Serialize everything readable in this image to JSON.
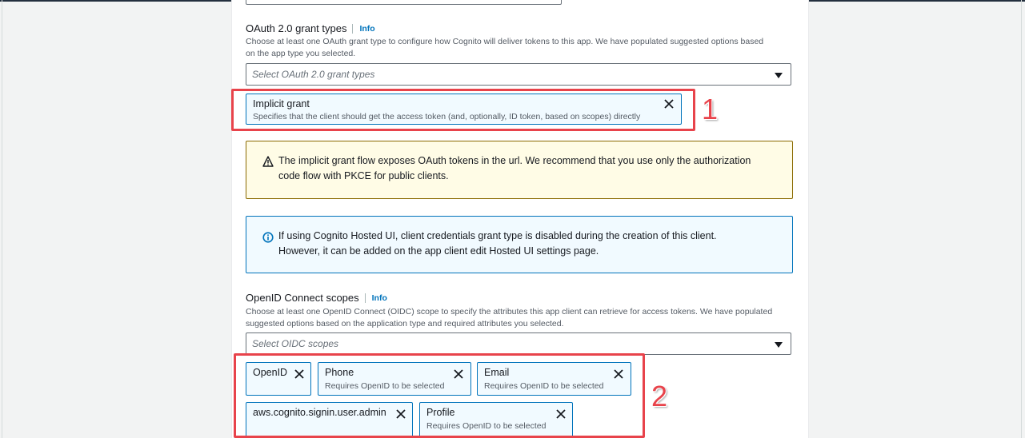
{
  "oauth_section": {
    "label": "OAuth 2.0 grant types",
    "info_link": "Info",
    "description_line1": "Choose at least one OAuth grant type to configure how Cognito will deliver tokens to this app. We have populated suggested options based",
    "description_line2": "on the app type you selected.",
    "select_placeholder": "Select OAuth 2.0 grant types",
    "selected_tokens": [
      {
        "label": "Implicit grant",
        "description": "Specifies that the client should get the access token (and, optionally, ID token, based on scopes) directly"
      }
    ]
  },
  "warning_alert": {
    "line1": "The implicit grant flow exposes OAuth tokens in the url. We recommend that you use only the authorization",
    "line2": "code flow with PKCE for public clients."
  },
  "info_alert": {
    "line1": "If using Cognito Hosted UI, client credentials grant type is disabled during the creation of this client.",
    "line2": "However, it can be added on the app client edit Hosted UI settings page."
  },
  "oidc_section": {
    "label": "OpenID Connect scopes",
    "info_link": "Info",
    "description_line1": "Choose at least one OpenID Connect (OIDC) scope to specify the attributes this app client can retrieve for access tokens. We have populated",
    "description_line2": "suggested options based on the application type and required attributes you selected.",
    "select_placeholder": "Select OIDC scopes",
    "selected_tokens": [
      {
        "label": "OpenID",
        "description": ""
      },
      {
        "label": "Phone",
        "description": "Requires OpenID to be selected"
      },
      {
        "label": "Email",
        "description": "Requires OpenID to be selected"
      },
      {
        "label": "aws.cognito.signin.user.admin",
        "description": ""
      },
      {
        "label": "Profile",
        "description": "Requires OpenID to be selected"
      }
    ]
  },
  "annotations": {
    "marker_1": "1",
    "marker_2": "2",
    "color": "#e8434b"
  },
  "colors": {
    "accent": "#0073bb",
    "warning_border": "#8a6a00",
    "warning_bg": "#fffce6",
    "info_bg": "#f1faff"
  },
  "icons": {
    "remove": "close-icon",
    "warning": "warning-icon",
    "info": "info-icon",
    "dropdown": "caret-down-icon"
  }
}
